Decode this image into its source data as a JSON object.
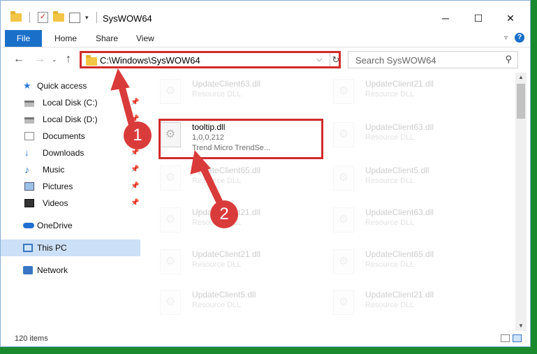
{
  "window": {
    "title": "SysWOW64",
    "controls": {
      "minimize": "─",
      "maximize": "☐",
      "close": "✕"
    }
  },
  "ribbon": {
    "tabs": [
      "File",
      "Home",
      "Share",
      "View"
    ],
    "help": "?"
  },
  "navigation": {
    "address": "C:\\Windows\\SysWOW64",
    "search_placeholder": "Search SysWOW64"
  },
  "sidebar": {
    "items": [
      {
        "label": "Quick access",
        "icon": "star-icon"
      },
      {
        "label": "Local Disk (C:)",
        "icon": "drive-icon",
        "pinned": true
      },
      {
        "label": "Local Disk (D:)",
        "icon": "drive-icon",
        "pinned": true
      },
      {
        "label": "Documents",
        "icon": "documents-icon",
        "pinned": true
      },
      {
        "label": "Downloads",
        "icon": "download-icon",
        "pinned": true
      },
      {
        "label": "Music",
        "icon": "music-icon",
        "pinned": true
      },
      {
        "label": "Pictures",
        "icon": "pictures-icon",
        "pinned": true
      },
      {
        "label": "Videos",
        "icon": "video-icon",
        "pinned": true
      },
      {
        "label": "OneDrive",
        "icon": "cloud-icon"
      },
      {
        "label": "This PC",
        "icon": "computer-icon",
        "selected": true
      },
      {
        "label": "Network",
        "icon": "network-icon"
      }
    ]
  },
  "files": [
    {
      "name": "UpdateClient63.dll",
      "type": "Resource DLL",
      "desc": "",
      "faded": true
    },
    {
      "name": "UpdateClient21.dll",
      "type": "Resource DLL",
      "desc": "",
      "faded": true
    },
    {
      "name": "tooltip.dll",
      "type": "1,0,0,212",
      "desc": "Trend Micro TrendSe...",
      "faded": false
    },
    {
      "name": "UpdateClient63.dll",
      "type": "Resource DLL",
      "desc": "",
      "faded": true
    },
    {
      "name": "UpdateClient65.dll",
      "type": "Resource DLL",
      "desc": "",
      "faded": true
    },
    {
      "name": "UpdateClient5.dll",
      "type": "Resource DLL",
      "desc": "",
      "faded": true
    },
    {
      "name": "UpdateClient21.dll",
      "type": "Resource DLL",
      "desc": "",
      "faded": true
    },
    {
      "name": "UpdateClient63.dll",
      "type": "Resource DLL",
      "desc": "",
      "faded": true
    },
    {
      "name": "UpdateClient21.dll",
      "type": "Resource DLL",
      "desc": "",
      "faded": true
    },
    {
      "name": "UpdateClient65.dll",
      "type": "Resource DLL",
      "desc": "",
      "faded": true
    },
    {
      "name": "UpdateClient5.dll",
      "type": "Resource DLL",
      "desc": "",
      "faded": true
    },
    {
      "name": "UpdateClient21.dll",
      "type": "Resource DLL",
      "desc": "",
      "faded": true
    }
  ],
  "status": {
    "item_count": "120 items"
  },
  "annotations": {
    "step1": "1",
    "step2": "2",
    "color": "#d93b3b"
  }
}
